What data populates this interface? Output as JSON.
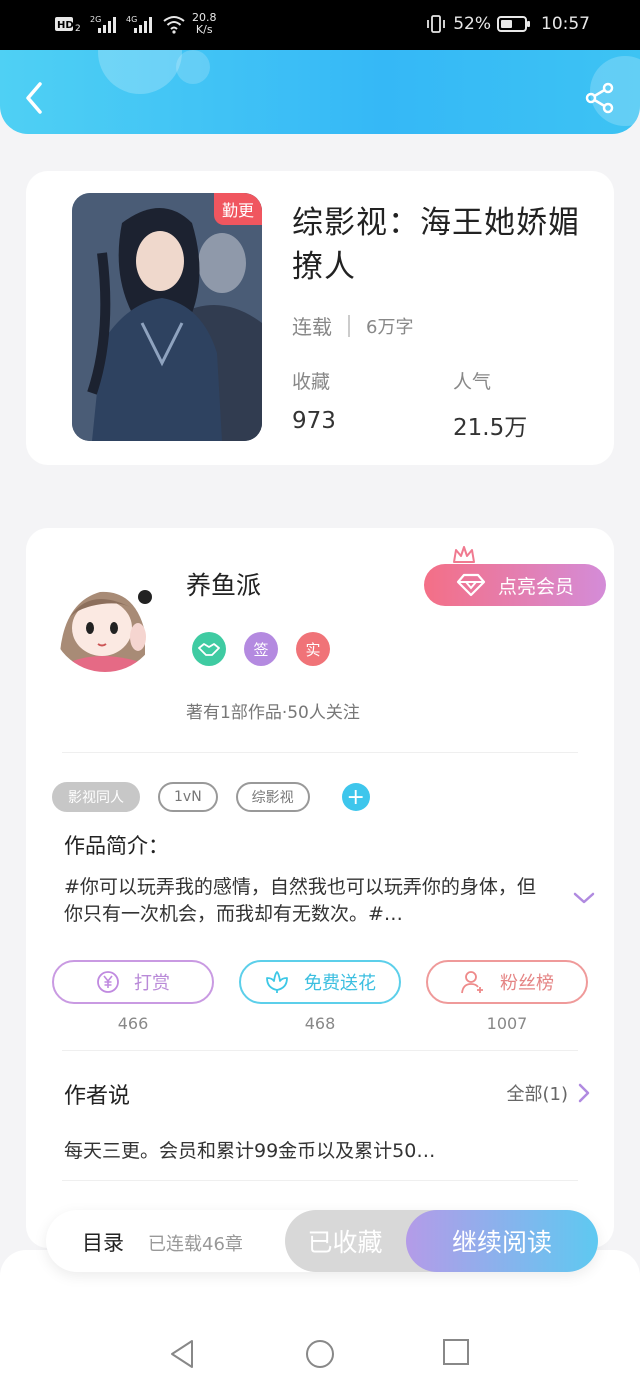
{
  "status_bar": {
    "network_left": "HD",
    "network_2": "2G",
    "network_4": "4G",
    "speed_value": "20.8",
    "speed_unit": "K/s",
    "battery": "52%",
    "battery_level": 0.52,
    "time": "10:57"
  },
  "header": {
    "back_icon": "chevron-left-icon",
    "share_icon": "share-icon"
  },
  "book": {
    "cover_badge": "勤更",
    "title": "综影视：海王她娇媚撩人",
    "status": "连载",
    "word_count": "6万字",
    "collect_label": "收藏",
    "collect_value": "973",
    "popularity_label": "人气",
    "popularity_value": "21.5万"
  },
  "author": {
    "name": "养鱼派",
    "vip_button": "点亮会员",
    "badges": [
      {
        "icon": "handshake-icon",
        "color": "#3fcba2"
      },
      {
        "text": "签",
        "color": "#b48ae0"
      },
      {
        "text": "实",
        "color": "#f07378"
      }
    ],
    "meta": "著有1部作品·50人关注"
  },
  "tags": [
    "影视同人",
    "1vN",
    "综影视"
  ],
  "intro": {
    "label": "作品简介：",
    "text": "#你可以玩弄我的感情，自然我也可以玩弄你的身体，但你只有一次机会，而我却有无数次。#…"
  },
  "actions": [
    {
      "label": "打赏",
      "count": "466",
      "icon": "yen-coin-icon",
      "color": "#c08ae0"
    },
    {
      "label": "免费送花",
      "count": "468",
      "icon": "flower-icon",
      "color": "#3ec8e6"
    },
    {
      "label": "粉丝榜",
      "count": "1007",
      "icon": "fan-user-icon",
      "color": "#ee8a8a"
    }
  ],
  "author_say": {
    "title": "作者说",
    "all_label": "全部(1)",
    "text": "每天三更。会员和累计99金币以及累计50…"
  },
  "bottom_bar": {
    "toc_label": "目录",
    "toc_sub": "已连载46章",
    "collected_label": "已收藏",
    "continue_label": "继续阅读"
  },
  "nav": {
    "back": "triangle-back-icon",
    "home": "circle-home-icon",
    "recent": "square-recent-icon"
  }
}
